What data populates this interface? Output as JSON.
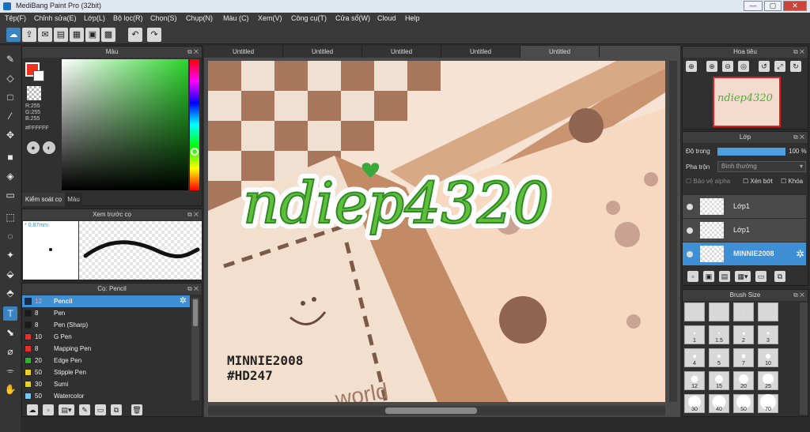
{
  "window": {
    "title": "MediBang Paint Pro (32bit)",
    "min": "—",
    "max": "▢",
    "close": "✕"
  },
  "menu": [
    "Tệp(F)",
    "Chỉnh sửa(E)",
    "Lớp(L)",
    "Bộ lọc(R)",
    "Chọn(S)",
    "Chụp(N)",
    "Màu (C)",
    "Xem(V)",
    "Công cụ(T)",
    "Cửa sổ(W)",
    "Cloud",
    "Help"
  ],
  "color_panel": {
    "title": "Màu",
    "r": "R:255",
    "g": "G:255",
    "b": "B:255",
    "hex": "#FFFFFF",
    "tab_control": "Kiểm soát cọ",
    "tab_color": "Màu"
  },
  "preview_panel": {
    "title": "Xem trước cọ",
    "size": "0.87mm"
  },
  "brush_panel": {
    "title": "Cọ: Pencil",
    "brushes": [
      {
        "size": "12",
        "name": "Pencil",
        "color": "#1d2a44",
        "selected": true
      },
      {
        "size": "8",
        "name": "Pen",
        "color": "#1a1a1a"
      },
      {
        "size": "8",
        "name": "Pen (Sharp)",
        "color": "#1a1a1a"
      },
      {
        "size": "10",
        "name": "G Pen",
        "color": "#e62e2e"
      },
      {
        "size": "8",
        "name": "Mapping Pen",
        "color": "#e62e2e"
      },
      {
        "size": "20",
        "name": "Edge Pen",
        "color": "#2fb12f"
      },
      {
        "size": "50",
        "name": "Stipple Pen",
        "color": "#e6d21e"
      },
      {
        "size": "30",
        "name": "Sumi",
        "color": "#e6d21e"
      },
      {
        "size": "50",
        "name": "Watercolor",
        "color": "#7cc4f0"
      }
    ]
  },
  "tabs": [
    "Untitled",
    "Untitled",
    "Untitled",
    "Untitled",
    "Untitled"
  ],
  "canvas": {
    "main_text": "ndiep4320",
    "credit_1": "MINNIE2008",
    "credit_2": "#HD247",
    "world_text": "world"
  },
  "navigator": {
    "title": "Hoa tiêu",
    "thumb_text": "ndiep4320"
  },
  "layer_panel": {
    "title": "Lớp",
    "opacity_label": "Độ trong",
    "opacity_value": "100 %",
    "opacity_fraction": 1.0,
    "blend_label": "Pha trộn",
    "blend_value": "Bình thường",
    "protect_alpha": "Bảo vệ alpha",
    "clipping": "Xén bớt",
    "lock": "Khóa",
    "layers": [
      {
        "name": "Lớp1",
        "selected": false
      },
      {
        "name": "Lớp1",
        "selected": false
      },
      {
        "name": "MINNIE2008",
        "selected": true
      }
    ]
  },
  "brush_size": {
    "title": "Brush Size",
    "sizes": [
      "",
      "",
      "",
      "",
      "1",
      "1.5",
      "2",
      "3",
      "4",
      "5",
      "7",
      "10",
      "12",
      "15",
      "20",
      "25",
      "30",
      "40",
      "50",
      "70"
    ]
  }
}
